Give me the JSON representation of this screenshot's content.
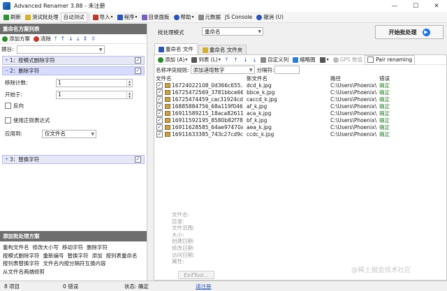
{
  "window": {
    "title": "Advanced Renamer 3.88 - 未注册",
    "minimize": "—",
    "maximize": "☐",
    "close": "✕"
  },
  "menu": {
    "refresh": "刷新",
    "test_batch": "测试批处理",
    "auto_test": "自动测试",
    "import": "导入",
    "program": "程序",
    "dir_panel": "目录面板",
    "help": "帮助",
    "metadata": "元数据",
    "js_console": "JS Console",
    "undo": "撤消 (U)"
  },
  "left": {
    "methods_header": "重命名方案列表",
    "add_method": "添加方案",
    "clear": "清除",
    "mode_label": "撰谷:",
    "rules": [
      {
        "label": "1：按模式删除字符",
        "checked": true
      },
      {
        "label": "2：删除字符",
        "checked": true
      },
      {
        "label": "3：替换字符",
        "checked": true
      }
    ],
    "remove_count_label": "移除计数:",
    "remove_count_value": "1",
    "start_at_label": "开始于:",
    "start_at_value": "1",
    "reverse_label": "反向",
    "regex_label": "使用正则表达式",
    "apply_to_label": "应用到:",
    "apply_to_value": "仅文件名",
    "batch_header": "添加批处理方案",
    "methods": [
      "重构文件名",
      "修改大小写",
      "移动字符",
      "删除字符",
      "按模式删除字符",
      "重新编号",
      "替换字符",
      "添加",
      "按列表重命名",
      "按列表替换字符",
      "文件名内按分隔符互换内容",
      "从文件名两端修剪"
    ]
  },
  "right": {
    "batch_mode_label": "批处理模式",
    "batch_mode_value": "重命名",
    "start_batch": "开始批处理",
    "tabs": [
      "重命名 文件",
      "重命名 文件夹"
    ],
    "toolbar": {
      "add": "添加 (A)",
      "list": "列表 (L)",
      "custom_cols": "自定义列",
      "thumbnails": "缩略图",
      "gps": "GPS 数值",
      "pair": "Pair renaming"
    },
    "conflict_label": "名称冲突规则:",
    "conflict_value": "添加递增数字",
    "separator_label": "分隔符:",
    "columns": [
      "文件名",
      "新文件名",
      "路径",
      "错误"
    ],
    "files": [
      {
        "name": "16724022108_0d366c655...",
        "new": "dcd_k.jpg",
        "path": "C:\\Users\\Phoenix\\...",
        "err": "确定"
      },
      {
        "name": "16725472569_3781bbce66...",
        "new": "bbce_k.jpg",
        "path": "C:\\Users\\Phoenix\\...",
        "err": "确定"
      },
      {
        "name": "16725474459_cac31924cd...",
        "new": "caccd_k.jpg",
        "path": "C:\\Users\\Phoenix\\...",
        "err": "确定"
      },
      {
        "name": "16885884756_68a119f046...",
        "new": "af_k.jpg",
        "path": "C:\\Users\\Phoenix\\...",
        "err": "确定"
      },
      {
        "name": "16911589215_18aca82611...",
        "new": "aca_k.jpg",
        "path": "C:\\Users\\Phoenix\\...",
        "err": "确定"
      },
      {
        "name": "16911592195_8580b82f78...",
        "new": "bf_k.jpg",
        "path": "C:\\Users\\Phoenix\\...",
        "err": "确定"
      },
      {
        "name": "16911628585_64ae97470a...",
        "new": "aea_k.jpg",
        "path": "C:\\Users\\Phoenix\\...",
        "err": "确定"
      },
      {
        "name": "16911633385_743c27cd9c...",
        "new": "ccdc_k.jpg",
        "path": "C:\\Users\\Phoenix\\...",
        "err": "确定"
      }
    ],
    "info_labels": [
      "文件名:",
      "目录:",
      "文件范围:",
      "大小:",
      "创建日期:",
      "修改日期:",
      "访问日期:",
      "属性:"
    ],
    "exiftool": "ExifTool..."
  },
  "status": {
    "items": "8 项目",
    "errors": "0 错误",
    "state": "状态: 确定",
    "register": "请注册"
  },
  "watermark": "@稀土掘金技术社区",
  "colors": {
    "accent": "#2a55b8",
    "ok_green": "#2c8a2c",
    "start_blue": "#1a73e8",
    "rule_bg": "#e6e8f8"
  }
}
